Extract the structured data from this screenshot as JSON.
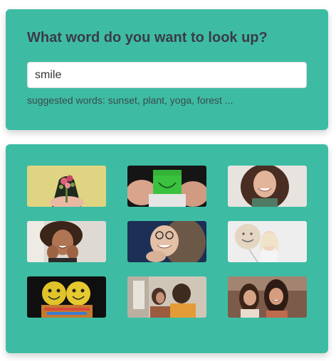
{
  "search": {
    "heading": "What word do you want to look up?",
    "query": "smile",
    "suggestions_text": "suggested words: sunset, plant, yoga, forest ..."
  },
  "results": {
    "images": [
      {
        "name": "flowers-bouquet-photo"
      },
      {
        "name": "green-smiley-note-photo"
      },
      {
        "name": "curly-woman-smiling-photo"
      },
      {
        "name": "woman-hands-on-cheeks-photo"
      },
      {
        "name": "woman-glasses-smiling-photo"
      },
      {
        "name": "smiley-balloon-photo"
      },
      {
        "name": "smiley-figurines-photo"
      },
      {
        "name": "two-women-talking-photo"
      },
      {
        "name": "two-women-laughing-photo"
      }
    ]
  },
  "colors": {
    "panel": "#3dbca3",
    "heading": "#3b3b46"
  }
}
